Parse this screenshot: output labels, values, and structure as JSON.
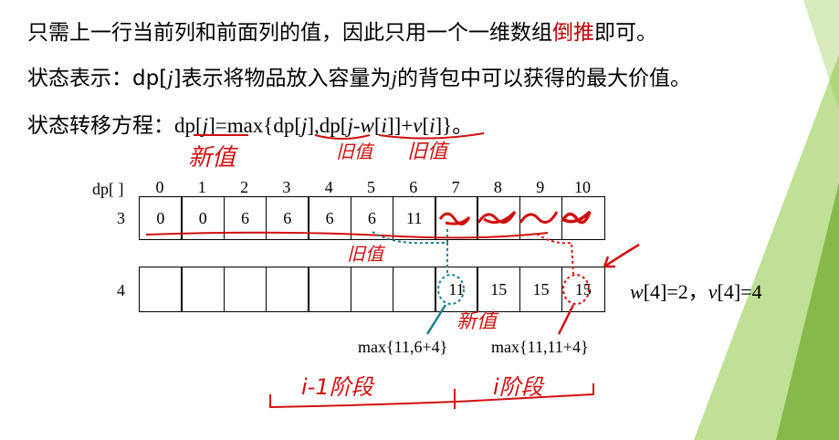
{
  "text": {
    "line1_a": "只需上一行当前列和前面列的值，因此只用一个一维数组",
    "line1_red": "倒推",
    "line1_b": "即可。",
    "line2_a": "状态表示：dp[",
    "line2_j": "j",
    "line2_b": "]表示将物品放入容量为",
    "line2_j2": "j",
    "line2_c": "的背包中可以获得的最大价值。",
    "line3_a": "状态转移方程：",
    "line3_formula_a": "dp[",
    "line3_j": "j",
    "line3_formula_b": "]=max{dp[",
    "line3_j2": "j",
    "line3_formula_c": "],dp[",
    "line3_j3": "j",
    "line3_formula_d": "-",
    "line3_w": "w",
    "line3_formula_e": "[",
    "line3_i": "i",
    "line3_formula_f": "]]+",
    "line3_v": "v",
    "line3_formula_g": "[",
    "line3_i2": "i",
    "line3_formula_h": "]}。"
  },
  "table": {
    "header_label": "dp[ ]",
    "indices": [
      "0",
      "1",
      "2",
      "3",
      "4",
      "5",
      "6",
      "7",
      "8",
      "9",
      "10"
    ],
    "row3_label": "3",
    "row3_values": [
      "0",
      "0",
      "6",
      "6",
      "6",
      "6",
      "11",
      "",
      "",
      "",
      ""
    ],
    "row4_label": "4",
    "row4_values": [
      "",
      "",
      "",
      "",
      "",
      "",
      "",
      "11",
      "15",
      "15",
      "15"
    ]
  },
  "item_info": {
    "w": "w",
    "w_text": "[4]=2，",
    "v": "v",
    "v_text": "[4]=4"
  },
  "max_labels": {
    "left": "max{11,6+4}",
    "right": "max{11,11+4}"
  },
  "annotations": {
    "new_value": "新值",
    "old_value_1": "旧值",
    "old_value_2": "旧值",
    "old_value_row": "旧值",
    "new_value_2": "新值",
    "stage_left": "i-1阶段",
    "stage_right": "i阶段"
  },
  "colors": {
    "accent_red": "#c00000",
    "handwriting_red": "#d01010",
    "teal": "#1a7f8a",
    "green_deco": "#8dc63f"
  }
}
